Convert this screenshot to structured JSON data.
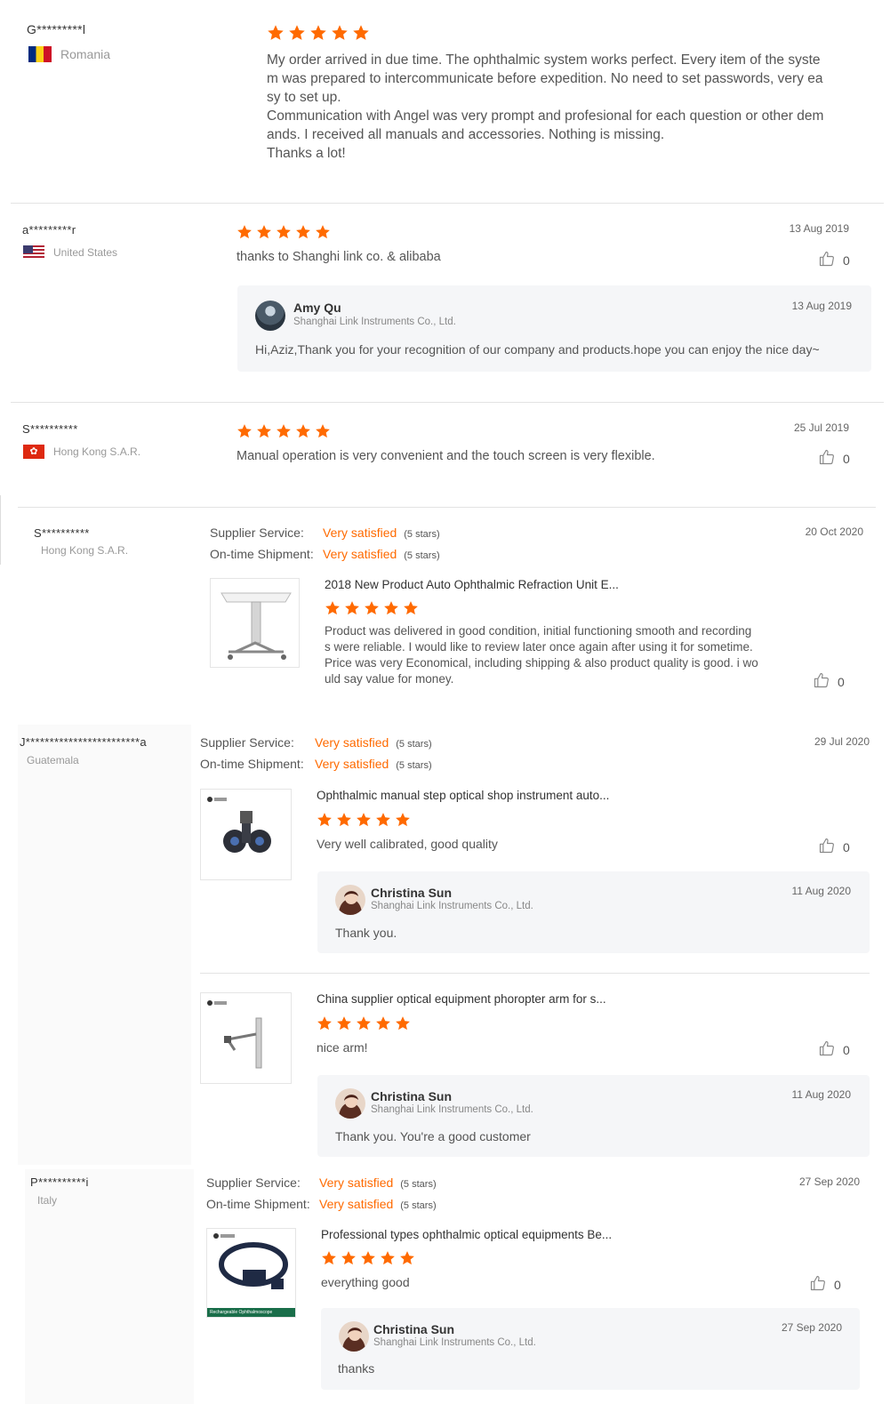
{
  "colors": {
    "accent": "#ff6a00",
    "star": "#ff6a00",
    "divider": "#e3e3e3",
    "reply_bg": "#f5f6f8"
  },
  "review1": {
    "user": "G*********l",
    "country": "Romania",
    "rating": 5,
    "lines": [
      "My order arrived in due time. The ophthalmic system works perfect. Every item of the syste",
      "m was prepared to intercommunicate before expedition. No need to set passwords, very ea",
      "sy to set up.",
      "Communication with Angel was very prompt and profesional for each question or other dem",
      "ands. I received all manuals and accessories. Nothing is missing.",
      "Thanks a lot!"
    ]
  },
  "review2": {
    "user": "a*********r",
    "country": "United States",
    "rating": 5,
    "date": "13 Aug 2019",
    "text": "thanks to Shanghi link co.  &  alibaba",
    "likes": "0",
    "reply": {
      "name": "Amy Qu",
      "company": "Shanghai Link Instruments Co., Ltd.",
      "date": "13 Aug 2019",
      "text": "Hi,Aziz,Thank you for your recognition of our company and products.hope you can enjoy the nice day~"
    }
  },
  "review3": {
    "user": "S**********",
    "country": "Hong Kong S.A.R.",
    "rating": 5,
    "date": "25 Jul 2019",
    "text": "Manual operation is very convenient and the touch screen is very flexible.",
    "likes": "0"
  },
  "review4": {
    "user": "S**********",
    "country": "Hong Kong S.A.R.",
    "date": "20 Oct 2020",
    "supplier_label": "Supplier Service:",
    "shipment_label": "On-time Shipment:",
    "supplier_value": "Very satisfied",
    "shipment_value": "Very satisfied",
    "supplier_stars": "(5 stars)",
    "shipment_stars": "(5 stars)",
    "product_title": "2018 New Product Auto Ophthalmic Refraction Unit E...",
    "rating": 5,
    "lines": [
      "Product was delivered in good condition, initial functioning smooth and recording",
      "s were reliable. I would like to review later once again after using it for sometime.",
      "Price was very Economical, including shipping & also product quality is good. i wo",
      "uld say value for money."
    ],
    "likes": "0"
  },
  "review5": {
    "user": "J************************a",
    "country": "Guatemala",
    "date": "29 Jul 2020",
    "supplier_label": "Supplier Service:",
    "shipment_label": "On-time Shipment:",
    "supplier_value": "Very satisfied",
    "shipment_value": "Very satisfied",
    "supplier_stars": "(5 stars)",
    "shipment_stars": "(5 stars)",
    "items": [
      {
        "product_title": "Ophthalmic manual step optical shop instrument auto...",
        "rating": 5,
        "text": "Very well calibrated, good quality",
        "likes": "0",
        "reply": {
          "name": "Christina Sun",
          "company": "Shanghai Link Instruments Co., Ltd.",
          "date": "11 Aug 2020",
          "text": "Thank you."
        }
      },
      {
        "product_title": "China supplier optical equipment phoropter arm for s...",
        "rating": 5,
        "text": "nice arm!",
        "likes": "0",
        "reply": {
          "name": "Christina Sun",
          "company": "Shanghai Link Instruments Co., Ltd.",
          "date": "11 Aug 2020",
          "text": "Thank you. You're a good customer"
        }
      }
    ]
  },
  "review6": {
    "user": "P**********i",
    "country": "Italy",
    "date": "27 Sep 2020",
    "supplier_label": "Supplier Service:",
    "shipment_label": "On-time Shipment:",
    "supplier_value": "Very satisfied",
    "shipment_value": "Very satisfied",
    "supplier_stars": "(5 stars)",
    "shipment_stars": "(5 stars)",
    "product_title": "Professional types ophthalmic optical equipments Be...",
    "rating": 5,
    "text": "everything good",
    "likes": "0",
    "product_thumb_caption": "Rechargeable Ophthalmoscope",
    "reply": {
      "name": "Christina Sun",
      "company": "Shanghai Link Instruments Co., Ltd.",
      "date": "27 Sep 2020",
      "text": "thanks"
    }
  }
}
